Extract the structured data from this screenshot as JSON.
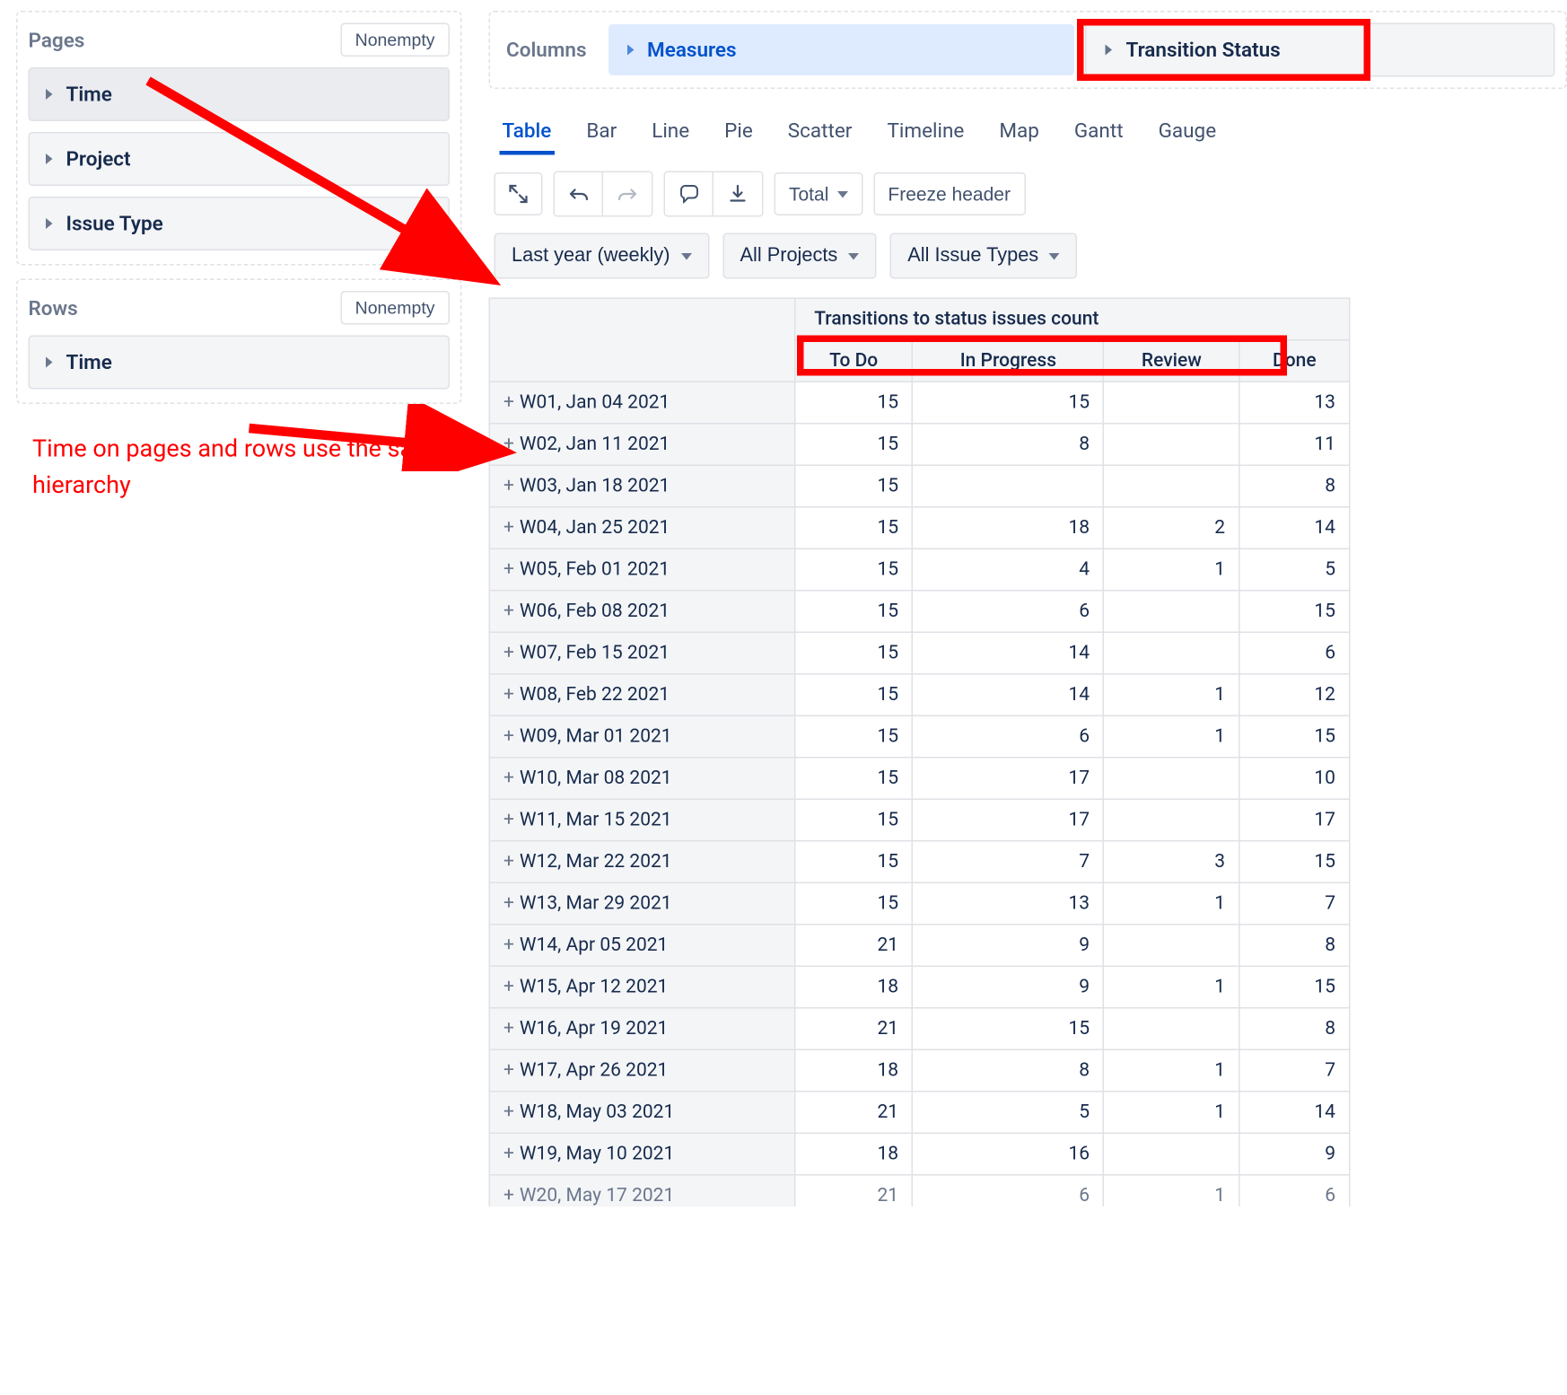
{
  "sidebar": {
    "pages": {
      "title": "Pages",
      "nonempty": "Nonempty",
      "items": [
        "Time",
        "Project",
        "Issue Type"
      ]
    },
    "rows": {
      "title": "Rows",
      "nonempty": "Nonempty",
      "items": [
        "Time"
      ]
    }
  },
  "annotation": "Time on pages and rows use the same hierarchy",
  "columns": {
    "label": "Columns",
    "chips": [
      "Measures",
      "Transition Status"
    ]
  },
  "chart_tabs": [
    "Table",
    "Bar",
    "Line",
    "Pie",
    "Scatter",
    "Timeline",
    "Map",
    "Gantt",
    "Gauge"
  ],
  "chart_tabs_active": "Table",
  "toolbar": {
    "total": "Total",
    "freeze": "Freeze header"
  },
  "filters": {
    "time": "Last year (weekly)",
    "project": "All Projects",
    "issuetype": "All Issue Types"
  },
  "table": {
    "metric": "Transitions to status issues count",
    "cols": [
      "To Do",
      "In Progress",
      "Review",
      "Done"
    ],
    "rows": [
      {
        "label": "W01, Jan 04 2021",
        "v": [
          "15",
          "15",
          "",
          "13"
        ]
      },
      {
        "label": "W02, Jan 11 2021",
        "v": [
          "15",
          "8",
          "",
          "11"
        ]
      },
      {
        "label": "W03, Jan 18 2021",
        "v": [
          "15",
          "",
          "",
          "8"
        ]
      },
      {
        "label": "W04, Jan 25 2021",
        "v": [
          "15",
          "18",
          "2",
          "14"
        ]
      },
      {
        "label": "W05, Feb 01 2021",
        "v": [
          "15",
          "4",
          "1",
          "5"
        ]
      },
      {
        "label": "W06, Feb 08 2021",
        "v": [
          "15",
          "6",
          "",
          "15"
        ]
      },
      {
        "label": "W07, Feb 15 2021",
        "v": [
          "15",
          "14",
          "",
          "6"
        ]
      },
      {
        "label": "W08, Feb 22 2021",
        "v": [
          "15",
          "14",
          "1",
          "12"
        ]
      },
      {
        "label": "W09, Mar 01 2021",
        "v": [
          "15",
          "6",
          "1",
          "15"
        ]
      },
      {
        "label": "W10, Mar 08 2021",
        "v": [
          "15",
          "17",
          "",
          "10"
        ]
      },
      {
        "label": "W11, Mar 15 2021",
        "v": [
          "15",
          "17",
          "",
          "17"
        ]
      },
      {
        "label": "W12, Mar 22 2021",
        "v": [
          "15",
          "7",
          "3",
          "15"
        ]
      },
      {
        "label": "W13, Mar 29 2021",
        "v": [
          "15",
          "13",
          "1",
          "7"
        ]
      },
      {
        "label": "W14, Apr 05 2021",
        "v": [
          "21",
          "9",
          "",
          "8"
        ]
      },
      {
        "label": "W15, Apr 12 2021",
        "v": [
          "18",
          "9",
          "1",
          "15"
        ]
      },
      {
        "label": "W16, Apr 19 2021",
        "v": [
          "21",
          "15",
          "",
          "8"
        ]
      },
      {
        "label": "W17, Apr 26 2021",
        "v": [
          "18",
          "8",
          "1",
          "7"
        ]
      },
      {
        "label": "W18, May 03 2021",
        "v": [
          "21",
          "5",
          "1",
          "14"
        ]
      },
      {
        "label": "W19, May 10 2021",
        "v": [
          "18",
          "16",
          "",
          "9"
        ]
      },
      {
        "label": "W20, May 17 2021",
        "v": [
          "21",
          "6",
          "1",
          "6"
        ],
        "cut": true
      }
    ]
  }
}
